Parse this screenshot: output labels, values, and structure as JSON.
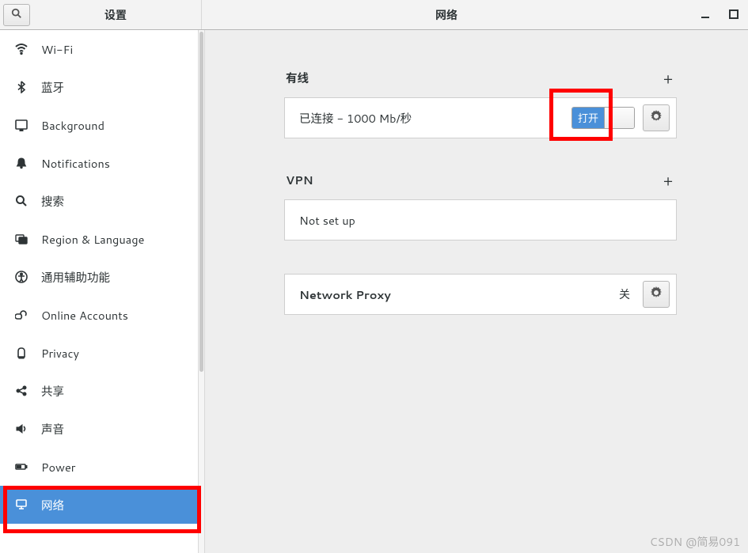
{
  "header": {
    "sidebar_title": "设置",
    "page_title": "网络"
  },
  "sidebar": {
    "items": [
      {
        "id": "wifi",
        "label": "Wi-Fi"
      },
      {
        "id": "bluetooth",
        "label": "蓝牙"
      },
      {
        "id": "background",
        "label": "Background"
      },
      {
        "id": "notifications",
        "label": "Notifications"
      },
      {
        "id": "search",
        "label": "搜索"
      },
      {
        "id": "region",
        "label": "Region & Language"
      },
      {
        "id": "accessibility",
        "label": "通用辅助功能"
      },
      {
        "id": "online",
        "label": "Online Accounts"
      },
      {
        "id": "privacy",
        "label": "Privacy"
      },
      {
        "id": "sharing",
        "label": "共享"
      },
      {
        "id": "sound",
        "label": "声音"
      },
      {
        "id": "power",
        "label": "Power"
      },
      {
        "id": "network",
        "label": "网络",
        "selected": true
      }
    ]
  },
  "sections": {
    "wired": {
      "title": "有线",
      "status": "已连接 - 1000 Mb/秒",
      "switch_on_label": "打开"
    },
    "vpn": {
      "title": "VPN",
      "status": "Not set up"
    },
    "proxy": {
      "title": "Network Proxy",
      "status": "关"
    }
  },
  "watermark": "CSDN @简易091"
}
